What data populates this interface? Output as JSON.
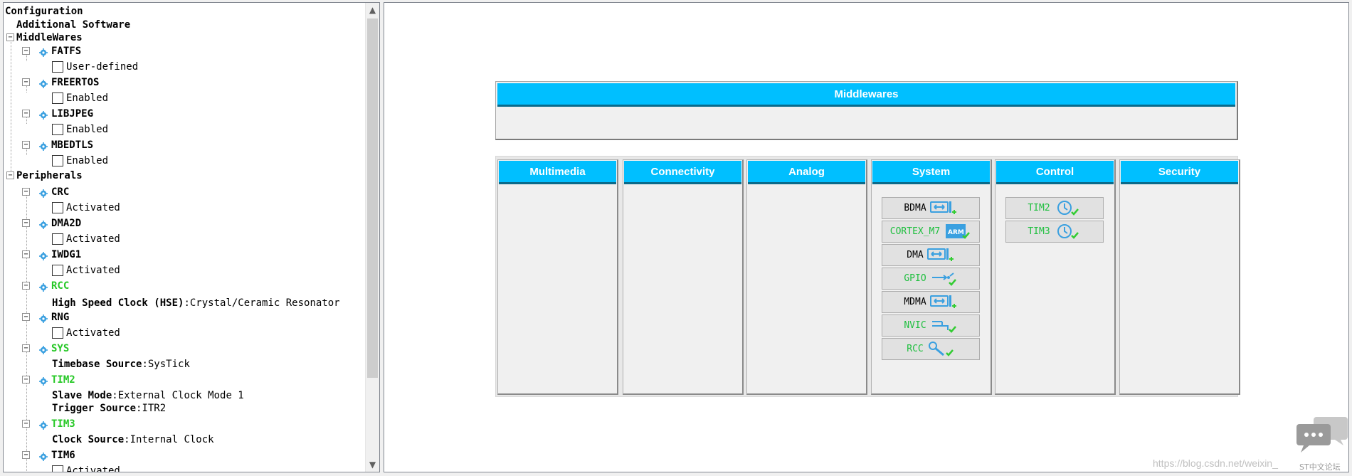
{
  "tree": {
    "rows": [
      {
        "label": "Configuration",
        "value": "",
        "style": "bold",
        "check": false,
        "gear": false,
        "exp": ""
      },
      {
        "label": "Additional Software",
        "value": "",
        "style": "bold",
        "check": false,
        "gear": false,
        "exp": ""
      },
      {
        "label": "MiddleWares",
        "value": "",
        "style": "bold",
        "check": false,
        "gear": false,
        "exp": "−"
      },
      {
        "label": "FATFS",
        "value": "",
        "style": "bold",
        "check": false,
        "gear": true,
        "exp": "−"
      },
      {
        "label": "User-defined",
        "value": "",
        "style": "normal",
        "check": true,
        "gear": false,
        "exp": ""
      },
      {
        "label": "FREERTOS",
        "value": "",
        "style": "bold",
        "check": false,
        "gear": true,
        "exp": "−"
      },
      {
        "label": "Enabled",
        "value": "",
        "style": "normal",
        "check": true,
        "gear": false,
        "exp": ""
      },
      {
        "label": "LIBJPEG",
        "value": "",
        "style": "bold",
        "check": false,
        "gear": true,
        "exp": "−"
      },
      {
        "label": "Enabled",
        "value": "",
        "style": "normal",
        "check": true,
        "gear": false,
        "exp": ""
      },
      {
        "label": "MBEDTLS",
        "value": "",
        "style": "bold",
        "check": false,
        "gear": true,
        "exp": "−"
      },
      {
        "label": "Enabled",
        "value": "",
        "style": "normal",
        "check": true,
        "gear": false,
        "exp": ""
      },
      {
        "label": "Peripherals",
        "value": "",
        "style": "bold",
        "check": false,
        "gear": false,
        "exp": "−"
      },
      {
        "label": "CRC",
        "value": "",
        "style": "bold",
        "check": false,
        "gear": true,
        "exp": "−"
      },
      {
        "label": "Activated",
        "value": "",
        "style": "normal",
        "check": true,
        "gear": false,
        "exp": ""
      },
      {
        "label": "DMA2D",
        "value": "",
        "style": "bold",
        "check": false,
        "gear": true,
        "exp": "−"
      },
      {
        "label": "Activated",
        "value": "",
        "style": "normal",
        "check": true,
        "gear": false,
        "exp": ""
      },
      {
        "label": "IWDG1",
        "value": "",
        "style": "bold",
        "check": false,
        "gear": true,
        "exp": "−"
      },
      {
        "label": "Activated",
        "value": "",
        "style": "normal",
        "check": true,
        "gear": false,
        "exp": ""
      },
      {
        "label": "RCC",
        "value": "",
        "style": "green",
        "check": false,
        "gear": true,
        "exp": "−"
      },
      {
        "label": "High Speed Clock (HSE)",
        "value": ":Crystal/Ceramic Resonator",
        "style": "bold",
        "check": false,
        "gear": false,
        "exp": ""
      },
      {
        "label": "RNG",
        "value": "",
        "style": "bold",
        "check": false,
        "gear": true,
        "exp": "−"
      },
      {
        "label": "Activated",
        "value": "",
        "style": "normal",
        "check": true,
        "gear": false,
        "exp": ""
      },
      {
        "label": "SYS",
        "value": "",
        "style": "green",
        "check": false,
        "gear": true,
        "exp": "−"
      },
      {
        "label": "Timebase Source",
        "value": ":SysTick",
        "style": "bold",
        "check": false,
        "gear": false,
        "exp": ""
      },
      {
        "label": "TIM2",
        "value": "",
        "style": "green",
        "check": false,
        "gear": true,
        "exp": "−"
      },
      {
        "label": "Slave Mode",
        "value": ":External Clock Mode 1",
        "style": "bold",
        "check": false,
        "gear": false,
        "exp": ""
      },
      {
        "label": "Trigger Source",
        "value": ":ITR2",
        "style": "bold",
        "check": false,
        "gear": false,
        "exp": ""
      },
      {
        "label": "TIM3",
        "value": "",
        "style": "green",
        "check": false,
        "gear": true,
        "exp": "−"
      },
      {
        "label": "Clock Source ",
        "value": ":Internal Clock",
        "style": "bold",
        "check": false,
        "gear": false,
        "exp": ""
      },
      {
        "label": "TIM6",
        "value": "",
        "style": "bold",
        "check": false,
        "gear": true,
        "exp": "−"
      },
      {
        "label": "Activated",
        "value": "",
        "style": "normal",
        "check": true,
        "gear": false,
        "exp": ""
      }
    ]
  },
  "middlewares": {
    "title": "Middlewares"
  },
  "categories": [
    {
      "name": "Multimedia",
      "items": []
    },
    {
      "name": "Connectivity",
      "items": []
    },
    {
      "name": "Analog",
      "items": []
    },
    {
      "name": "System",
      "items": [
        {
          "label": "BDMA",
          "icon": "dma-add-icon",
          "green": false
        },
        {
          "label": "CORTEX_M7",
          "icon": "arm-check-icon",
          "green": true
        },
        {
          "label": "DMA",
          "icon": "dma-add-icon",
          "green": false
        },
        {
          "label": "GPIO",
          "icon": "gpio-check-icon",
          "green": true
        },
        {
          "label": "MDMA",
          "icon": "dma-add-icon",
          "green": false
        },
        {
          "label": "NVIC",
          "icon": "nvic-check-icon",
          "green": true
        },
        {
          "label": "RCC",
          "icon": "wrench-check-icon",
          "green": true
        }
      ]
    },
    {
      "name": "Control",
      "items": [
        {
          "label": "TIM2",
          "icon": "clock-check-icon",
          "green": true
        },
        {
          "label": "TIM3",
          "icon": "clock-check-icon",
          "green": true
        }
      ]
    },
    {
      "name": "Security",
      "items": []
    }
  ],
  "watermark": {
    "url": "https://blog.csdn.net/weixin_",
    "brand": "ST中文论坛",
    "logo_icon": "chat-bubbles-icon"
  },
  "colors": {
    "header_blue": "#00bfff",
    "enabled_green": "#1fbf3f",
    "check_green": "#33cc33",
    "icon_blue": "#3aa0e0"
  }
}
